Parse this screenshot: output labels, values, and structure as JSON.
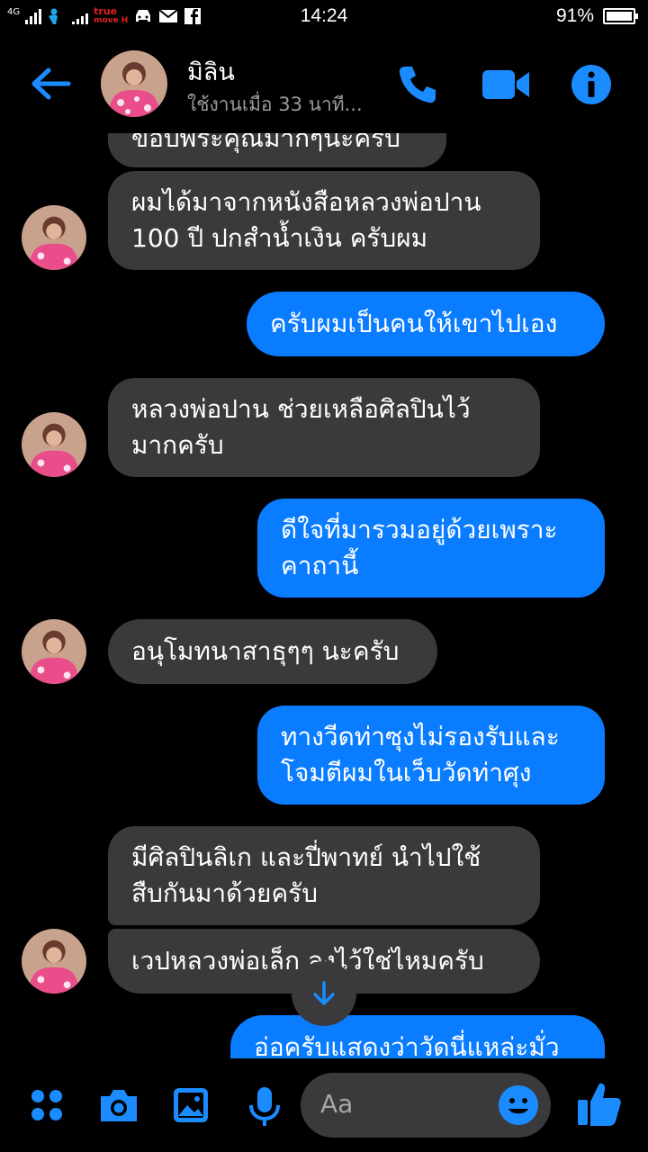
{
  "status_bar": {
    "network": "4G",
    "carrier_line1": "true",
    "carrier_line2": "move H",
    "time": "14:24",
    "battery": "91%",
    "battery_level": 0.91
  },
  "header": {
    "contact_name": "มิลิน",
    "contact_status": "ใช้งานเมื่อ 33 นาที...",
    "icons": [
      "back-arrow-icon",
      "phone-icon",
      "video-camera-icon",
      "info-icon"
    ],
    "accent_color": "#1a8cff"
  },
  "messages": [
    {
      "direction": "in",
      "text": "ขอบพระคุณมากๆนะครับ",
      "lines": [
        "ขอบพระคุณมากๆนะครับ"
      ]
    },
    {
      "direction": "in",
      "lines": [
        "ผมได้มาจากหนังสือหลวงพ่อปาน",
        "100 ปี ปกสำน้ำเงิน ครับผม"
      ]
    },
    {
      "direction": "out",
      "lines": [
        "ครับผมเป็นคนให้เขาไปเอง"
      ]
    },
    {
      "direction": "in",
      "lines": [
        "หลวงพ่อปาน ช่วยเหลือศิลปินไว้",
        "มากครับ"
      ]
    },
    {
      "direction": "out",
      "lines": [
        "ดีใจที่มารวมอยู่ด้วยเพราะ",
        "คาถานี้"
      ]
    },
    {
      "direction": "in",
      "lines": [
        "อนุโมทนาสาธุๆๆ นะครับ"
      ]
    },
    {
      "direction": "out",
      "lines": [
        "ทางวีดท่าซุงไม่รองรับและ",
        "โจมตีผมในเว็บวัดท่าศุง"
      ]
    },
    {
      "direction": "in",
      "lines": [
        "มีศิลปินลิเก และปี่พาทย์ นำไปใช้",
        "สืบกันมาด้วยครับ"
      ]
    },
    {
      "direction": "in",
      "lines": [
        "เวปหลวงพ่อเล็ก ลงไว้ใช่ไหมครับ"
      ]
    },
    {
      "direction": "out",
      "lines": [
        "อ่อครับแสดงว่าวัดนี่แหล่ะมั่ว"
      ]
    }
  ],
  "composer": {
    "placeholder": "Aa",
    "icons": [
      "apps-grid-icon",
      "camera-icon",
      "photo-gallery-icon",
      "microphone-icon",
      "emoji-icon",
      "thumbs-up-icon"
    ]
  },
  "colors": {
    "incoming_bubble": "#3a3a3c",
    "outgoing_bubble": "#0a7cff",
    "background": "#000000"
  }
}
